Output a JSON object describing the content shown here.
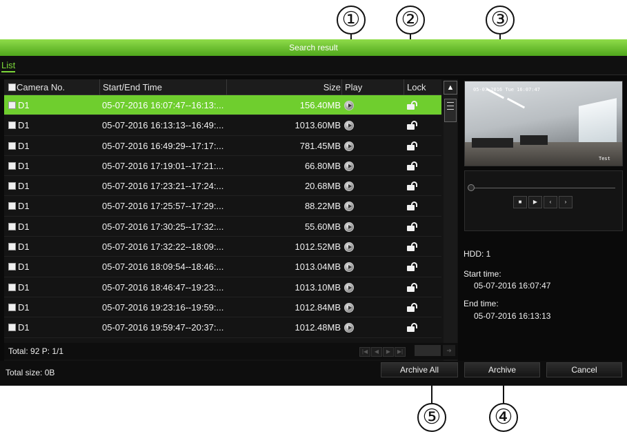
{
  "window": {
    "title": "Search result",
    "tab": "List"
  },
  "table": {
    "headers": {
      "camera": "Camera No.",
      "time": "Start/End Time",
      "size": "Size",
      "play": "Play",
      "lock": "Lock"
    },
    "rows": [
      {
        "camera": "D1",
        "time": "05-07-2016 16:07:47--16:13:...",
        "size": "156.40MB",
        "selected": true
      },
      {
        "camera": "D1",
        "time": "05-07-2016 16:13:13--16:49:...",
        "size": "1013.60MB"
      },
      {
        "camera": "D1",
        "time": "05-07-2016 16:49:29--17:17:...",
        "size": "781.45MB"
      },
      {
        "camera": "D1",
        "time": "05-07-2016 17:19:01--17:21:...",
        "size": "66.80MB"
      },
      {
        "camera": "D1",
        "time": "05-07-2016 17:23:21--17:24:...",
        "size": "20.68MB"
      },
      {
        "camera": "D1",
        "time": "05-07-2016 17:25:57--17:29:...",
        "size": "88.22MB"
      },
      {
        "camera": "D1",
        "time": "05-07-2016 17:30:25--17:32:...",
        "size": "55.60MB"
      },
      {
        "camera": "D1",
        "time": "05-07-2016 17:32:22--18:09:...",
        "size": "1012.52MB"
      },
      {
        "camera": "D1",
        "time": "05-07-2016 18:09:54--18:46:...",
        "size": "1013.04MB"
      },
      {
        "camera": "D1",
        "time": "05-07-2016 18:46:47--19:23:...",
        "size": "1013.10MB"
      },
      {
        "camera": "D1",
        "time": "05-07-2016 19:23:16--19:59:...",
        "size": "1012.84MB"
      },
      {
        "camera": "D1",
        "time": "05-07-2016 19:59:47--20:37:...",
        "size": "1012.48MB"
      }
    ],
    "total": "Total: 92  P: 1/1"
  },
  "footer": {
    "total_size": "Total size: 0B",
    "archive_all": "Archive All",
    "archive": "Archive",
    "cancel": "Cancel"
  },
  "preview": {
    "osd_top": "05-07-2016 Tue 16:07:47",
    "osd_bottom": "Test"
  },
  "info": {
    "hdd": "HDD: 1",
    "start_label": "Start time:",
    "start_value": "05-07-2016 16:07:47",
    "end_label": "End time:",
    "end_value": "05-07-2016 16:13:13"
  },
  "callouts": [
    "①",
    "②",
    "③",
    "④",
    "⑤"
  ],
  "icons": {
    "play": "play-icon",
    "lock": "lock-open-icon",
    "scroll_up": "chevron-up-icon",
    "scroll_down": "chevron-down-icon"
  },
  "colors": {
    "accent": "#6fce2e",
    "title_bar": "#5fb82a"
  }
}
